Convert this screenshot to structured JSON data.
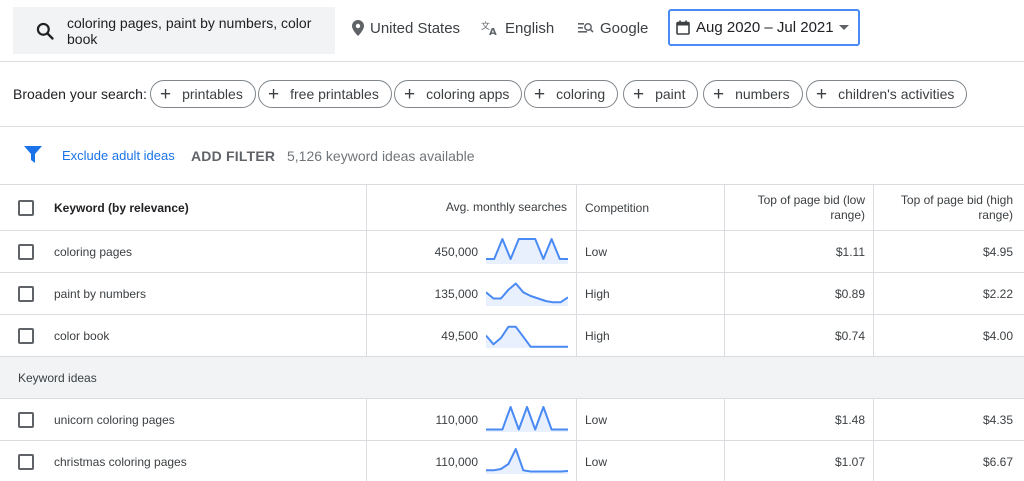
{
  "search": {
    "query": "coloring pages, paint by numbers, color book"
  },
  "topbar": {
    "location": "United States",
    "language": "English",
    "network": "Google",
    "date_range": "Aug 2020 – Jul 2021"
  },
  "broaden": {
    "label": "Broaden your search:",
    "chips": [
      "printables",
      "free printables",
      "coloring apps",
      "coloring",
      "paint",
      "numbers",
      "children's activities"
    ]
  },
  "filters": {
    "exclude": "Exclude adult ideas",
    "add_filter": "ADD FILTER",
    "ideas_available": "5,126 keyword ideas available"
  },
  "table": {
    "headers": {
      "keyword": "Keyword (by relevance)",
      "searches": "Avg. monthly searches",
      "competition": "Competition",
      "bid_low": "Top of page bid (low range)",
      "bid_high": "Top of page bid (high range)"
    },
    "provided_rows": [
      {
        "keyword": "coloring pages",
        "searches": "450,000",
        "competition": "Low",
        "bid_low": "$1.11",
        "bid_high": "$4.95",
        "trend": [
          0.2,
          0.2,
          1,
          0.2,
          1,
          1,
          1,
          0.2,
          1,
          0.2,
          0.2
        ]
      },
      {
        "keyword": "paint by numbers",
        "searches": "135,000",
        "competition": "High",
        "bid_low": "$0.89",
        "bid_high": "$2.22",
        "trend": [
          0.55,
          0.3,
          0.3,
          0.65,
          0.9,
          0.55,
          0.4,
          0.3,
          0.2,
          0.15,
          0.15,
          0.35
        ]
      },
      {
        "keyword": "color book",
        "searches": "49,500",
        "competition": "High",
        "bid_low": "$0.74",
        "bid_high": "$4.00",
        "trend": [
          0.5,
          0.15,
          0.4,
          0.85,
          0.85,
          0.45,
          0.05,
          0.05,
          0.05,
          0.05,
          0.05,
          0.05
        ]
      }
    ],
    "section_label": "Keyword ideas",
    "idea_rows": [
      {
        "keyword": "unicorn coloring pages",
        "searches": "110,000",
        "competition": "Low",
        "bid_low": "$1.48",
        "bid_high": "$4.35",
        "trend": [
          0.1,
          0.1,
          0.1,
          1,
          0.1,
          1,
          0.1,
          1,
          0.1,
          0.1,
          0.1
        ]
      },
      {
        "keyword": "christmas coloring pages",
        "searches": "110,000",
        "competition": "Low",
        "bid_low": "$1.07",
        "bid_high": "$6.67",
        "trend": [
          0.15,
          0.15,
          0.2,
          0.4,
          1,
          0.15,
          0.1,
          0.1,
          0.1,
          0.1,
          0.1,
          0.12
        ]
      }
    ]
  },
  "colors": {
    "accent": "#1a73e8",
    "spark_line": "#4a8af4",
    "spark_fill": "#e8f0fe",
    "border": "#dadce0",
    "section_bg": "#f1f3f4"
  }
}
